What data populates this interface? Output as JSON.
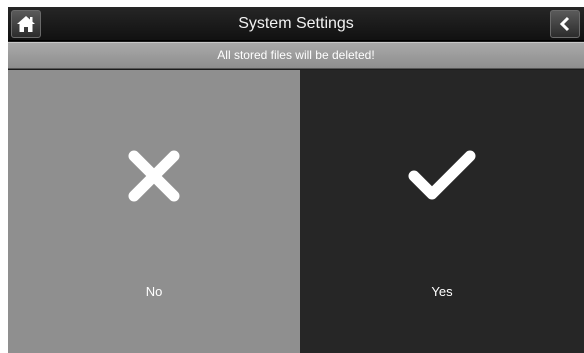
{
  "header": {
    "title": "System Settings",
    "home_icon": "home-icon",
    "back_icon": "chevron-left-icon"
  },
  "warning": {
    "message": "All stored files will be deleted!"
  },
  "options": {
    "no": {
      "label": "No",
      "icon": "close-icon",
      "background": "#8f8f8f"
    },
    "yes": {
      "label": "Yes",
      "icon": "checkmark-icon",
      "background": "#262626"
    }
  }
}
